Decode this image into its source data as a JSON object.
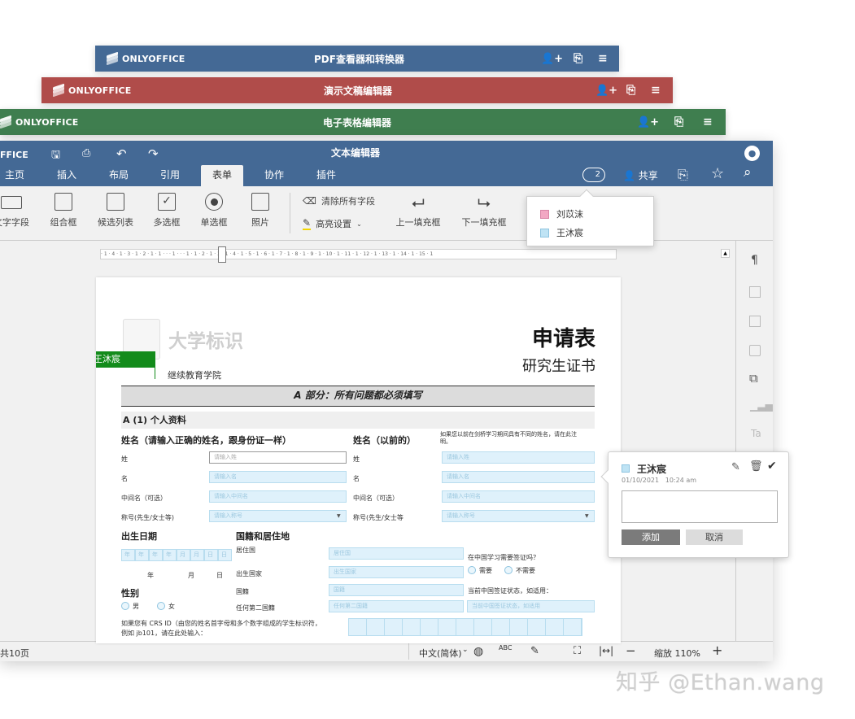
{
  "windows": {
    "pdf": {
      "title": "PDF查看器和转换器",
      "color": "#446995"
    },
    "presentation": {
      "title": "演示文稿编辑器",
      "color": "#b04c4a"
    },
    "spreadsheet": {
      "title": "电子表格编辑器",
      "color": "#3f7e4f"
    },
    "brand": "ONLYOFFICE"
  },
  "main": {
    "brand_partial": "FFICE",
    "title": "文本编辑器",
    "tabs": [
      "主页",
      "插入",
      "布局",
      "引用",
      "表单",
      "协作",
      "插件"
    ],
    "active_tab": "表单",
    "users_count": "2",
    "share_label": "共享"
  },
  "toolbar": {
    "text_field": "文字字段",
    "combo_box": "组合框",
    "dropdown": "候选列表",
    "checkbox": "多选框",
    "radio": "单选框",
    "image": "照片",
    "clear_fields": "清除所有字段",
    "highlight": "高亮设置",
    "prev_field": "上一填充框",
    "next_field": "下一填充框"
  },
  "ruler": "· 1 · 4 · 1 · 3 · 1 · 2 · 1 · 1 · · · 1 · · · 1 · 1 · 2 · 1 · 3 · 1 · 4 · 1 · 5 · 1 · 6 · 1 · 7 · 1 · 8 · 1 · 9 · 1 · 10 · 1 · 11 · 1 · 12 · 1 · 13 · 1 · 14 · 1 · 15 · 1",
  "users_popup": {
    "users": [
      {
        "name": "刘苡沫",
        "color": "#f2a7c3"
      },
      {
        "name": "王沐宸",
        "color": "#bfe3f4"
      }
    ]
  },
  "document": {
    "logo_text": "大学标识",
    "school": "继续教育学院",
    "title": "申请表",
    "subtitle": "研究生证书",
    "editor_tag": "王沐宸",
    "part_a": "A 部分：所有问题都必须填写",
    "section_personal": "A (1) 个人资料",
    "name_header": "姓名（请输入正确的姓名，跟身份证一样）",
    "former_name_header": "姓名（以前的）",
    "former_note": "如果您以前在剑桥学习期间具有不同的姓名，请在此注明。",
    "rows": [
      {
        "label": "姓",
        "placeholder": "请输入姓"
      },
      {
        "label": "名",
        "placeholder": "请输入名"
      },
      {
        "label": "中间名（可选）",
        "placeholder": "请输入中间名"
      },
      {
        "label": "称号(先生/女士等)",
        "placeholder": "请输入称号"
      }
    ],
    "rows_right": [
      {
        "label": "姓",
        "placeholder": "请输入姓"
      },
      {
        "label": "名",
        "placeholder": "请输入名"
      },
      {
        "label": "中间名（可选）",
        "placeholder": "请输入中间名"
      },
      {
        "label": "称号(先生/女士等",
        "placeholder": "请输入称号"
      }
    ],
    "dob_header": "出生日期",
    "dob_cells": [
      "年",
      "年",
      "年",
      "年",
      "月",
      "月",
      "日",
      "日"
    ],
    "dob_year": "年",
    "dob_month": "月",
    "dob_day": "日",
    "nationality_header": "国籍和居住地",
    "nat_rows": [
      {
        "label": "居住国",
        "placeholder": "居住国"
      },
      {
        "label": "出生国家",
        "placeholder": "出生国家"
      },
      {
        "label": "国籍",
        "placeholder": "国籍"
      },
      {
        "label": "任何第二国籍",
        "placeholder": "任何第二国籍"
      }
    ],
    "visa_question": "在中国学习需要签证吗？",
    "visa_yes": "需要",
    "visa_no": "不需要",
    "visa_status": "当前中国签证状态，如适用：",
    "visa_status_placeholder": "当前中国签证状态，如适用",
    "gender_header": "性别",
    "male": "男",
    "female": "女",
    "crs_text_1": "如果您有 CRS ID（由您的姓名首字母和多个数字组成的学生标识符，",
    "crs_text_2": "例如 jb101，请在此处输入："
  },
  "comment": {
    "user": "王沐宸",
    "date": "01/10/2021",
    "time": "10:24 am",
    "add": "添加",
    "cancel": "取消"
  },
  "status": {
    "pages": "共10页",
    "language": "中文(简体)",
    "zoom": "缩放 110%"
  },
  "watermark": "知乎 @Ethan.wang"
}
